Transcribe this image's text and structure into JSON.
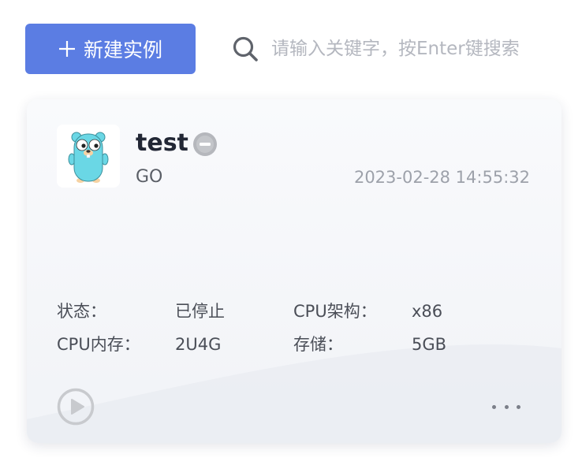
{
  "toolbar": {
    "new_instance_label": "新建实例",
    "search": {
      "placeholder": "请输入关键字，按Enter键搜索",
      "value": ""
    }
  },
  "instance_card": {
    "name": "test",
    "status_icon": "minus-circle-icon",
    "language": "GO",
    "language_logo": "go-gopher-icon",
    "created_time": "2023-02-28 14:55:32",
    "details": {
      "status_label": "状态：",
      "status_value": "已停止",
      "cpu_arch_label": "CPU架构：",
      "cpu_arch_value": "x86",
      "cpu_memory_label": "CPU内存：",
      "cpu_memory_value": "2U4G",
      "storage_label": "存储：",
      "storage_value": "5GB"
    },
    "actions": {
      "start_icon": "play-circle-icon",
      "more_icon": "more-horizontal-icon"
    }
  },
  "colors": {
    "primary": "#5b7de3",
    "title_text": "#222735",
    "muted_text": "#9da1aa",
    "stopped_badge": "#b5b7bc"
  }
}
